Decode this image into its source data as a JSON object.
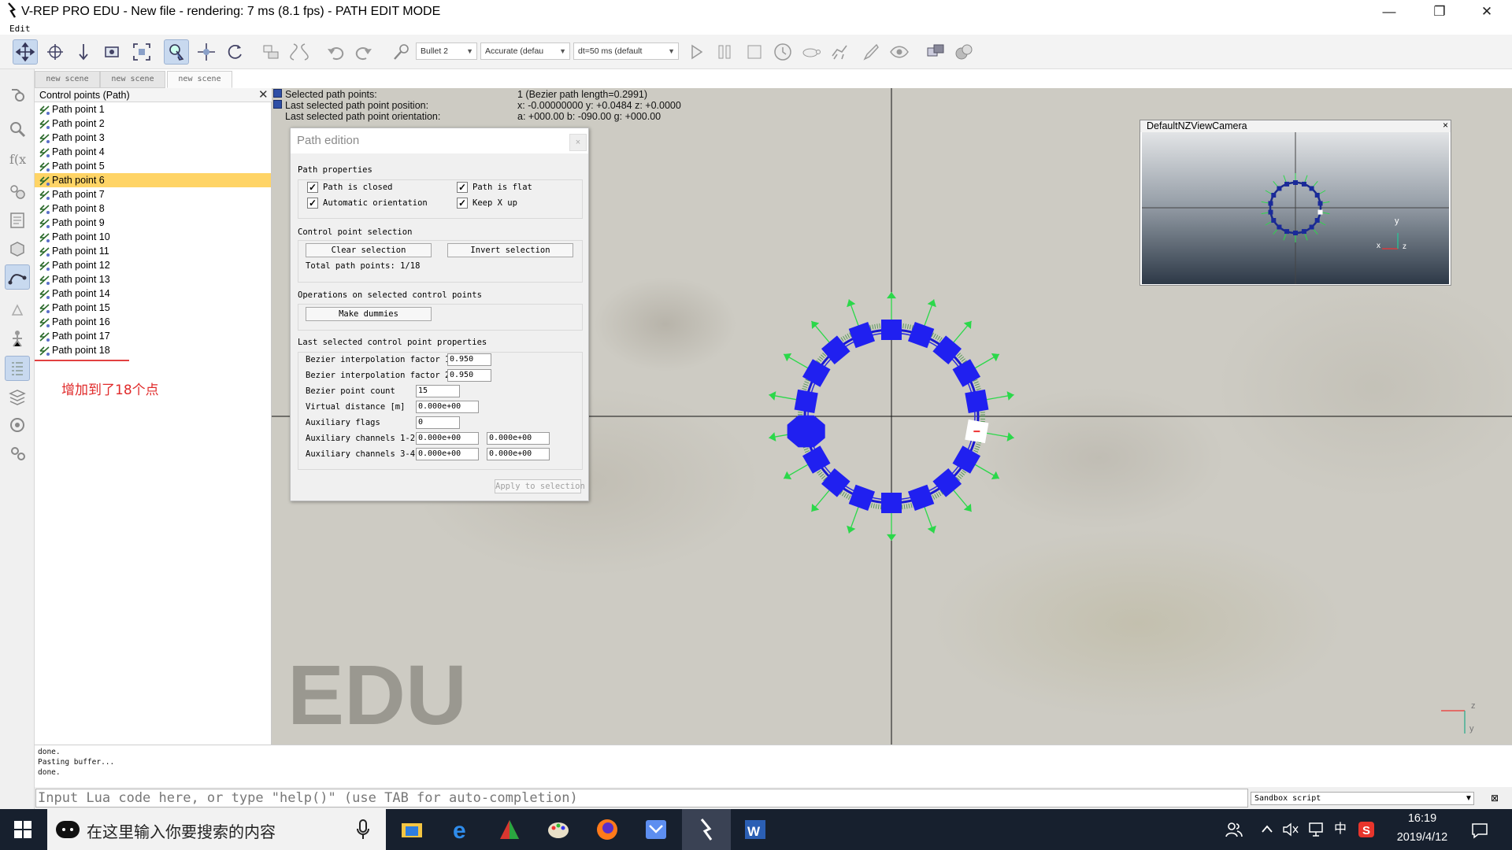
{
  "window": {
    "title": "V-REP PRO EDU - New file - rendering: 7 ms (8.1 fps) - PATH EDIT MODE",
    "menu": [
      "Edit"
    ],
    "minimize_glyph": "—",
    "restore_glyph": "❐",
    "close_glyph": "✕"
  },
  "toolbar": {
    "icons": [
      "camera-pan-icon",
      "camera-rotate-icon",
      "camera-shift-icon",
      "camera-angle-icon",
      "fit-to-view-icon",
      "object-select-icon",
      "object-shift-icon",
      "object-rotate-icon",
      "assemble-icon",
      "transfer-dna-icon",
      "undo-icon",
      "redo-icon",
      "pick-icon"
    ],
    "engine_select": "Bullet 2",
    "accuracy_select": "Accurate (defau",
    "timestep_select": "dt=50 ms (default",
    "sim_icons": [
      "play-icon",
      "pause-icon",
      "stop-icon",
      "realtime-icon",
      "slower-icon",
      "faster-icon",
      "thread-icon",
      "visualization-icon",
      "page-icon",
      "scene-icon"
    ]
  },
  "left_strip": {
    "icons": [
      "scene-settings-icon",
      "zoom-icon",
      "calculation-icon",
      "collection-icon",
      "scripts-icon",
      "shape-edit-icon",
      "path-edit-icon",
      "model-browser-icon",
      "scene-hierarchy-icon",
      "layers-icon",
      "selection-icon",
      "user-settings-icon"
    ]
  },
  "scene_tabs": [
    "new scene",
    "new scene",
    "new scene"
  ],
  "hierarchy": {
    "title": "Control points (Path)",
    "items": [
      "Path point 1",
      "Path point 2",
      "Path point 3",
      "Path point 4",
      "Path point 5",
      "Path point 6",
      "Path point 7",
      "Path point 8",
      "Path point 9",
      "Path point 10",
      "Path point 11",
      "Path point 12",
      "Path point 13",
      "Path point 14",
      "Path point 15",
      "Path point 16",
      "Path point 17",
      "Path point 18"
    ],
    "selected_index": 5,
    "annotation": "增加到了18个点"
  },
  "viewport": {
    "info": [
      {
        "label": "Selected path points:",
        "value": "1 (Bezier path length=0.2991)"
      },
      {
        "label": "Last selected path point position:",
        "value": "x: -0.00000000   y: +0.0484   z: +0.0000"
      },
      {
        "label": "Last selected path point orientation:",
        "value": "a: +000.00   b: -090.00   g: +000.00"
      }
    ],
    "watermark": "EDU",
    "axis_x": "x",
    "axis_y": "y",
    "axis_z": "z"
  },
  "path_dialog": {
    "title": "Path edition",
    "close_glyph": "×",
    "path_properties_label": "Path properties",
    "path_closed": {
      "label": "Path is closed",
      "checked": true
    },
    "path_flat": {
      "label": "Path is flat",
      "checked": true
    },
    "auto_orientation": {
      "label": "Automatic orientation",
      "checked": true
    },
    "keep_x_up": {
      "label": "Keep X up",
      "checked": true
    },
    "check_glyph": "✓",
    "selection_label": "Control point selection",
    "clear_selection": "Clear selection",
    "invert_selection": "Invert selection",
    "total_points": "Total path points: 1/18",
    "operations_label": "Operations on selected control points",
    "make_dummies": "Make dummies",
    "last_props_label": "Last selected control point properties",
    "bezier1": {
      "label": "Bezier interpolation factor 1",
      "value": "0.950"
    },
    "bezier2": {
      "label": "Bezier interpolation factor 2",
      "value": "0.950"
    },
    "bezier_count": {
      "label": "Bezier point count",
      "value": "15"
    },
    "virtual_distance": {
      "label": "Virtual distance [m]",
      "value": "0.000e+00"
    },
    "aux_flags": {
      "label": "Auxiliary flags",
      "value": "0"
    },
    "aux12": {
      "label": "Auxiliary channels 1-2",
      "value1": "0.000e+00",
      "value2": "0.000e+00"
    },
    "aux34": {
      "label": "Auxiliary channels 3-4",
      "value1": "0.000e+00",
      "value2": "0.000e+00"
    },
    "apply": "Apply to selection"
  },
  "camera": {
    "title": "DefaultNZViewCamera",
    "close_glyph": "×"
  },
  "console": {
    "lines": [
      "done.",
      "Pasting buffer...",
      "done."
    ],
    "placeholder": "Input Lua code here, or type \"help()\" (use TAB for auto-completion)",
    "script_select": "Sandbox script",
    "close_glyph": "⊠"
  },
  "taskbar": {
    "search_placeholder": "在这里输入你要搜索的内容",
    "apps": [
      "file-explorer-icon",
      "edge-icon",
      "wps-icon",
      "paint-icon",
      "firefox-icon",
      "message-icon",
      "vrep-icon",
      "word-icon"
    ],
    "tray_ime": "中",
    "time": "16:19",
    "date": "2019/4/12"
  },
  "colors": {
    "accent_selected": "#ffd466",
    "path_blue": "#2233ee",
    "annotation_red": "#e02a2a",
    "taskbar": "#17202e"
  }
}
